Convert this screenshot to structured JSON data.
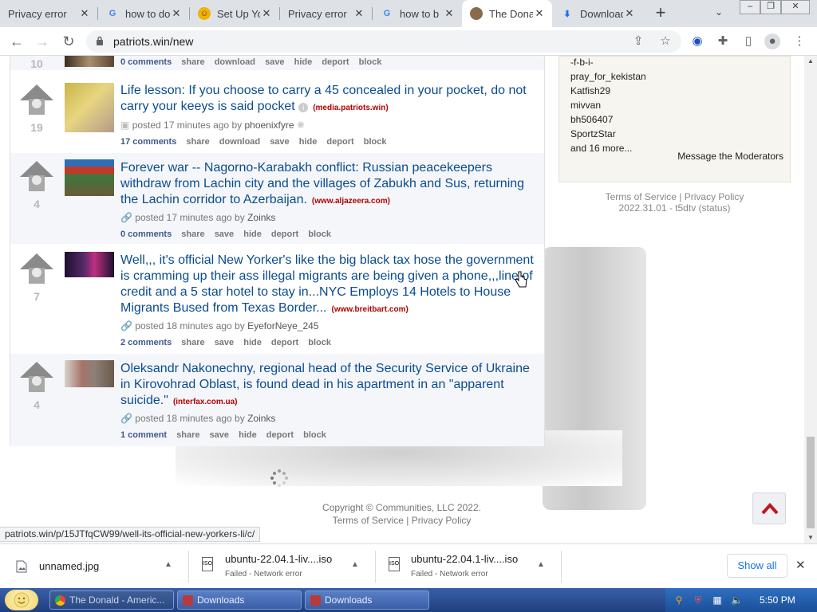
{
  "tabs": [
    {
      "title": "Privacy error",
      "icon": "none"
    },
    {
      "title": "how to do",
      "icon": "google-icon"
    },
    {
      "title": "Set Up Yo",
      "icon": "person-icon"
    },
    {
      "title": "Privacy error",
      "icon": "none"
    },
    {
      "title": "how to b",
      "icon": "google-icon"
    },
    {
      "title": "The Donald",
      "icon": "site-icon"
    },
    {
      "title": "Downloads",
      "icon": "download-icon"
    }
  ],
  "toolbar": {
    "url": "patriots.win/new"
  },
  "posts": [
    {
      "rank": "10",
      "comments": "0 comments",
      "actions": [
        "share",
        "download",
        "save",
        "hide",
        "deport",
        "block"
      ]
    },
    {
      "rank": "19",
      "title": "Life lesson: If you choose to carry a 45 concealed in your pocket, do not carry your keeys is said pocket",
      "domain": "(media.patriots.win)",
      "meta": "posted 17 minutes ago by",
      "author": "phoenixfyre",
      "comments": "17 comments",
      "actions": [
        "share",
        "download",
        "save",
        "hide",
        "deport",
        "block"
      ]
    },
    {
      "rank": "4",
      "title": "Forever war -- Nagorno-Karabakh conflict: Russian peacekeepers withdraw from Lachin city and the villages of Zabukh and Sus, returning the Lachin corridor to Azerbaijan.",
      "domain": "(www.aljazeera.com)",
      "meta": "posted 17 minutes ago by",
      "author": "Zoinks",
      "comments": "0 comments",
      "actions": [
        "share",
        "save",
        "hide",
        "deport",
        "block"
      ]
    },
    {
      "rank": "7",
      "title": "Well,,, it's official New Yorker's like the big black tax hose the government is cramming up their ass illegal migrants are being given a phone,,,line of credit and a 5 star hotel to stay in...NYC Employs 14 Hotels to House Migrants Bused from Texas Border...",
      "domain": "(www.breitbart.com)",
      "meta": "posted 18 minutes ago by",
      "author": "EyeforNeye_245",
      "comments": "2 comments",
      "actions": [
        "share",
        "save",
        "hide",
        "deport",
        "block"
      ]
    },
    {
      "rank": "4",
      "title": "Oleksandr Nakonechny, regional head of the Security Service of Ukraine in Kirovohrad Oblast, is found dead in his apartment in an \"apparent suicide.\"",
      "domain": "(interfax.com.ua)",
      "meta": "posted 18 minutes ago by",
      "author": "Zoinks",
      "comments": "1 comment",
      "actions": [
        "share",
        "save",
        "hide",
        "deport",
        "block"
      ]
    }
  ],
  "sidebar": {
    "moderators": [
      "-f-b-i-",
      "pray_for_kekistan",
      "Katfish29",
      "mivvan",
      "bh506407",
      "SportzStar",
      "and 16 more..."
    ],
    "message": "Message the Moderators",
    "terms": "Terms of Service",
    "sep": "|",
    "privacy": "Privacy Policy",
    "version": "2022.31.01 - t5dtv (status)"
  },
  "footer": {
    "copyright": "Copyright © Communities, LLC 2022.",
    "terms": "Terms of Service",
    "sep": "|",
    "privacy": "Privacy Policy"
  },
  "status_url": "patriots.win/p/15JTfqCW99/well-its-official-new-yorkers-li/c/",
  "downloads": [
    {
      "name": "unnamed.jpg",
      "status": ""
    },
    {
      "name": "ubuntu-22.04.1-liv....iso",
      "status": "Failed - Network error"
    },
    {
      "name": "ubuntu-22.04.1-liv....iso",
      "status": "Failed - Network error"
    }
  ],
  "show_all": "Show all",
  "taskbar": {
    "items": [
      "The Donald - Americ...",
      "Downloads",
      "Downloads"
    ],
    "clock": "5:50 PM"
  },
  "colors": {
    "link": "#0a4c8f",
    "domain": "#b20000",
    "totop": "#c0161c"
  }
}
